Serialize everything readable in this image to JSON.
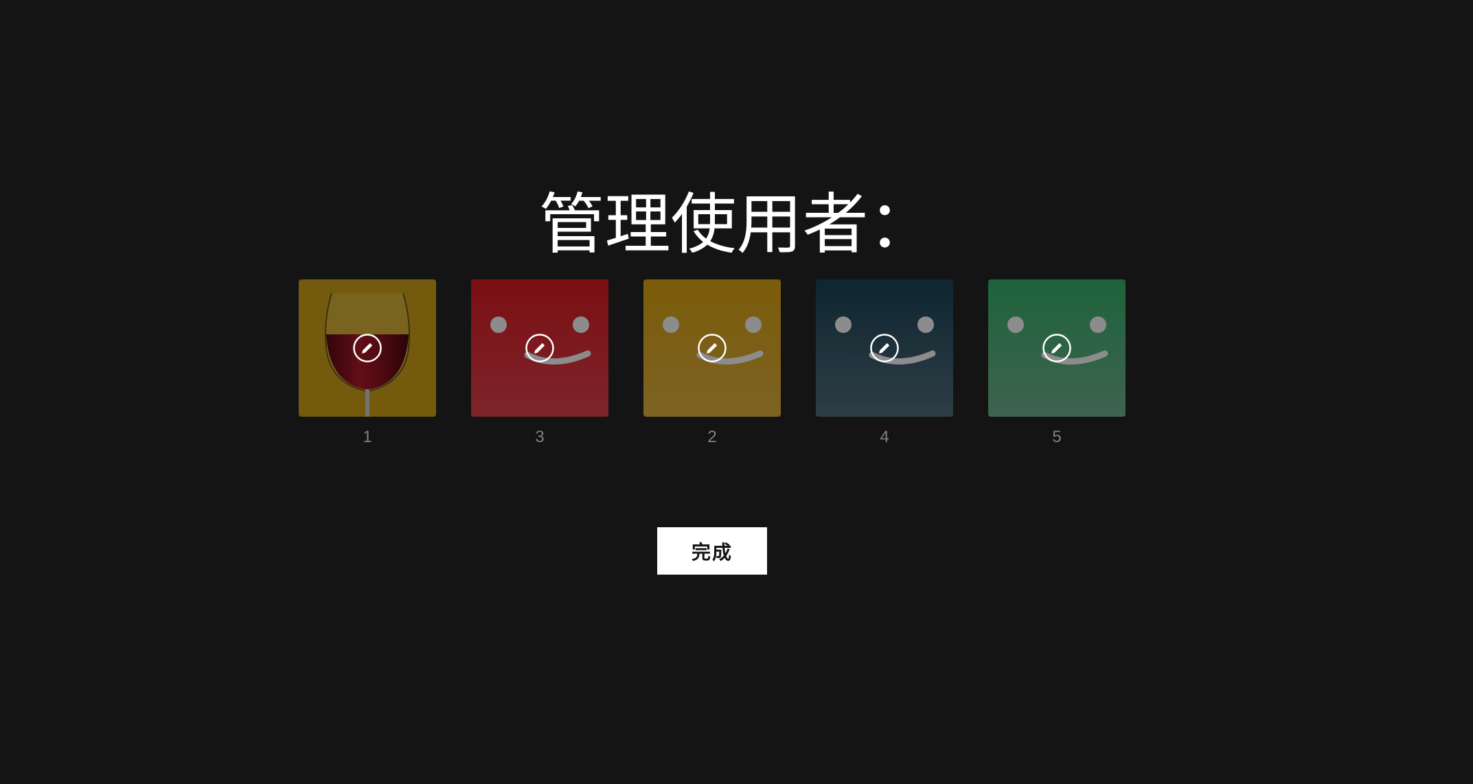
{
  "page_title": "管理使用者：",
  "profiles": [
    {
      "name": "1",
      "avatar": "wine-glass",
      "color": "#d4a416"
    },
    {
      "name": "3",
      "avatar": "smiley",
      "color": "#d21a24"
    },
    {
      "name": "2",
      "avatar": "smiley",
      "color": "#e0ac1c"
    },
    {
      "name": "4",
      "avatar": "smiley",
      "color": "#1b4c5d"
    },
    {
      "name": "5",
      "avatar": "smiley",
      "color": "#3bbd75"
    }
  ],
  "edit_icon": "pencil-icon",
  "done_label": "完成",
  "colors": {
    "background": "#141414",
    "text": "#ffffff",
    "muted_text": "#808080"
  }
}
